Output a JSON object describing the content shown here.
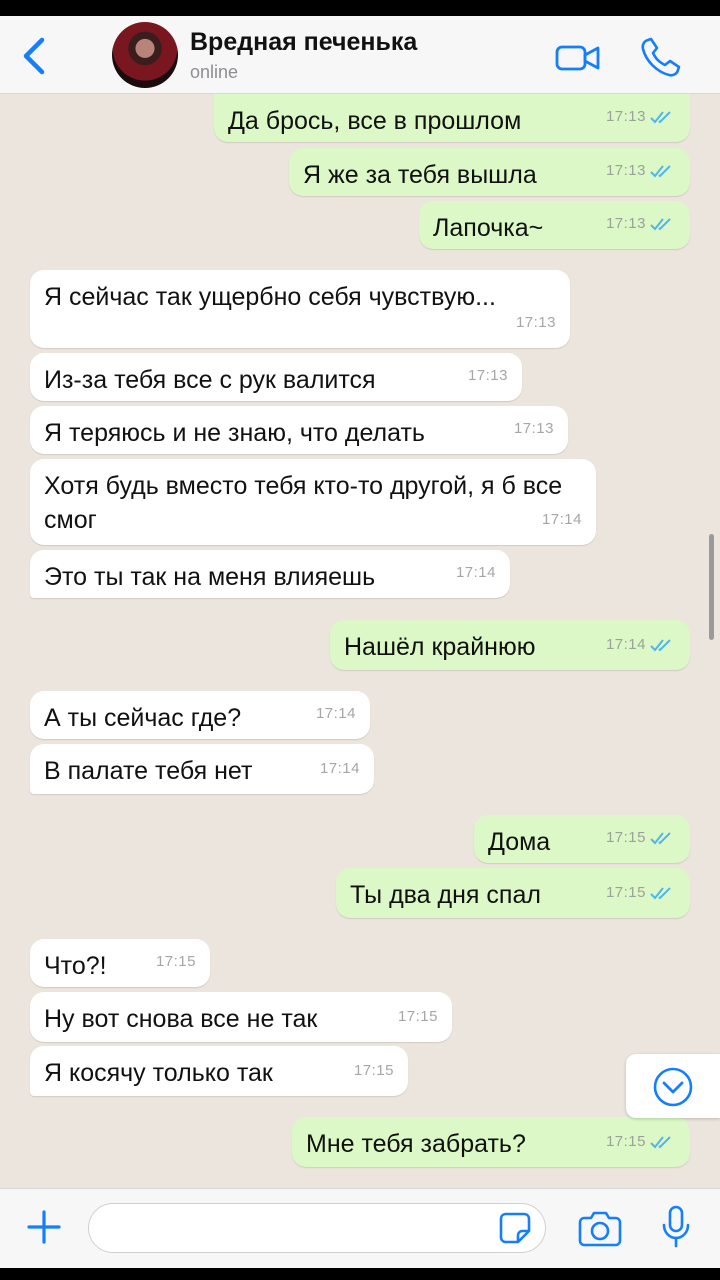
{
  "header": {
    "title": "Вредная печенька",
    "status": "online"
  },
  "messages": [
    {
      "dir": "out",
      "text": "Да брось, все в прошлом",
      "time": "17:13"
    },
    {
      "dir": "out",
      "text": "Я же за тебя вышла",
      "time": "17:13"
    },
    {
      "dir": "out",
      "text": "Лапочка~",
      "time": "17:13"
    },
    {
      "dir": "in",
      "text": "Я сейчас так ущербно себя чувствую...",
      "time": "17:13"
    },
    {
      "dir": "in",
      "text": "Из-за тебя все с рук валится",
      "time": "17:13"
    },
    {
      "dir": "in",
      "text": "Я теряюсь и не знаю, что делать",
      "time": "17:13"
    },
    {
      "dir": "in",
      "text": "Хотя будь вместо тебя кто-то другой, я б все смог",
      "time": "17:14"
    },
    {
      "dir": "in",
      "text": "Это ты так на меня влияешь",
      "time": "17:14"
    },
    {
      "dir": "out",
      "text": "Нашёл крайнюю",
      "time": "17:14"
    },
    {
      "dir": "in",
      "text": "А ты сейчас где?",
      "time": "17:14"
    },
    {
      "dir": "in",
      "text": "В палате тебя нет",
      "time": "17:14"
    },
    {
      "dir": "out",
      "text": "Дома",
      "time": "17:15"
    },
    {
      "dir": "out",
      "text": "Ты два дня спал",
      "time": "17:15"
    },
    {
      "dir": "in",
      "text": "Что?!",
      "time": "17:15"
    },
    {
      "dir": "in",
      "text": "Ну вот снова все не так",
      "time": "17:15"
    },
    {
      "dir": "in",
      "text": "Я косячу только так",
      "time": "17:15"
    },
    {
      "dir": "out",
      "text": "Мне тебя забрать?",
      "time": "17:15"
    }
  ],
  "composer": {
    "value": ""
  },
  "colors": {
    "accent": "#147efb",
    "outgoing_bubble": "#dcf8c6",
    "incoming_bubble": "#ffffff",
    "chat_background": "#ece5dd",
    "read_ticks": "#4fb6ec"
  },
  "icons": {
    "back": "chevron-left-icon",
    "video": "video-camera-icon",
    "call": "phone-icon",
    "scroll": "chevron-down-icon",
    "attach": "plus-icon",
    "sticker": "sticker-icon",
    "camera": "camera-icon",
    "mic": "microphone-icon"
  }
}
